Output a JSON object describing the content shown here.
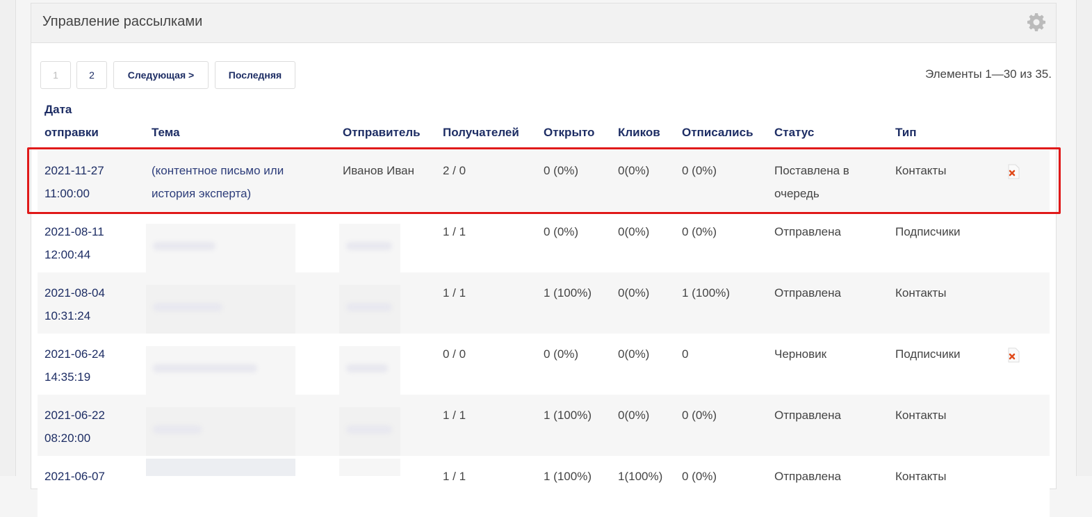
{
  "panel": {
    "title": "Управление рассылками"
  },
  "pager": {
    "pages": [
      "1",
      "2"
    ],
    "next_label": "Следующая >",
    "last_label": "Последняя"
  },
  "summary": "Элементы 1—30 из 35.",
  "columns": {
    "date_line1": "Дата",
    "date_line2": "отправки",
    "subject": "Тема",
    "sender": "Отправитель",
    "recipients": "Получателей",
    "opened": "Открыто",
    "clicks": "Кликов",
    "unsub": "Отписались",
    "status": "Статус",
    "type": "Тип"
  },
  "rows": [
    {
      "date": "2021-11-27",
      "time": "11:00:00",
      "subject_line1": "(контентное письмо или",
      "subject_line2": "история эксперта)",
      "sender": "Иванов Иван",
      "recipients": "2 / 0",
      "opened": "0 (0%)",
      "clicks": "0(0%)",
      "unsub": "0 (0%)",
      "status_line1": "Поставлена в",
      "status_line2": "очередь",
      "type": "Контакты",
      "deletable": true
    },
    {
      "date": "2021-08-11",
      "time": "12:00:44",
      "recipients": "1 / 1",
      "opened": "0 (0%)",
      "clicks": "0(0%)",
      "unsub": "0 (0%)",
      "status_line1": "Отправлена",
      "type": "Подписчики",
      "deletable": false
    },
    {
      "date": "2021-08-04",
      "time": "10:31:24",
      "recipients": "1 / 1",
      "opened": "1 (100%)",
      "clicks": "0(0%)",
      "unsub": "1 (100%)",
      "status_line1": "Отправлена",
      "type": "Контакты",
      "deletable": false
    },
    {
      "date": "2021-06-24",
      "time": "14:35:19",
      "recipients": "0 / 0",
      "opened": "0 (0%)",
      "clicks": "0(0%)",
      "unsub": "0",
      "status_line1": "Черновик",
      "type": "Подписчики",
      "deletable": true
    },
    {
      "date": "2021-06-22",
      "time": "08:20:00",
      "recipients": "1 / 1",
      "opened": "1 (100%)",
      "clicks": "0(0%)",
      "unsub": "0 (0%)",
      "status_line1": "Отправлена",
      "type": "Контакты",
      "deletable": false
    },
    {
      "date": "2021-06-07",
      "time": "",
      "recipients": "1 / 1",
      "opened": "1 (100%)",
      "clicks": "1(100%)",
      "unsub": "0 (0%)",
      "status_line1": "Отправлена",
      "type": "Контакты",
      "deletable": false
    }
  ],
  "colors": {
    "accent": "#1d2d64",
    "highlight": "#e01a1a",
    "delete_icon": "#e04a1a"
  }
}
